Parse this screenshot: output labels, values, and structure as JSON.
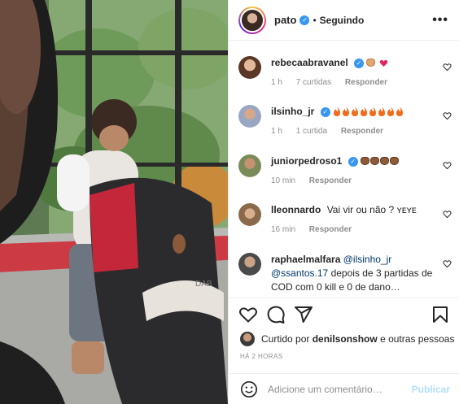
{
  "header": {
    "username": "pato",
    "separator": "•",
    "follow_status": "Seguindo",
    "more_label": "•••"
  },
  "comments": [
    {
      "username": "rebecaabravanel",
      "text": "",
      "emoji": [
        "fist-light",
        "heart-red"
      ],
      "time": "1 h",
      "likes": "7 curtidas",
      "reply": "Responder",
      "verified": true
    },
    {
      "username": "ilsinho_jr",
      "text": "",
      "emoji": [
        "fire",
        "fire",
        "fire",
        "fire",
        "fire",
        "fire",
        "fire",
        "fire"
      ],
      "time": "1 h",
      "likes": "1 curtida",
      "reply": "Responder",
      "verified": true
    },
    {
      "username": "juniorpedroso1",
      "text": "",
      "emoji": [
        "fist-dark",
        "fist-dark",
        "fist-dark",
        "fist-dark"
      ],
      "time": "10 min",
      "likes": "",
      "reply": "Responder",
      "verified": true
    },
    {
      "username": "lleonnardo",
      "text": "Vai vir ou não ? ʏᴇʏᴇ",
      "emoji": [],
      "time": "16 min",
      "likes": "",
      "reply": "Responder",
      "verified": false
    },
    {
      "username": "raphaelmalfara",
      "mention1": "@ilsinho_jr",
      "mention2": "@ssantos.17",
      "text_after": "depois de 3 partidas de COD com 0 kill e 0 de dano…",
      "verified": false
    }
  ],
  "actions": {
    "like": "heart-outline-icon",
    "comment": "comment-icon",
    "share": "paper-plane-icon",
    "save": "bookmark-icon"
  },
  "liked_by": {
    "prefix": "Curtido por",
    "user": "denilsonshow",
    "suffix": "e outras pessoas"
  },
  "time_ago": "HÁ 2 HORAS",
  "composer": {
    "placeholder": "Adicione um comentário…",
    "publish_label": "Publicar"
  },
  "colors": {
    "verified": "#3897f0",
    "link": "#00376b",
    "publish_disabled": "#b2dffc",
    "muted": "#8e8e8e"
  }
}
